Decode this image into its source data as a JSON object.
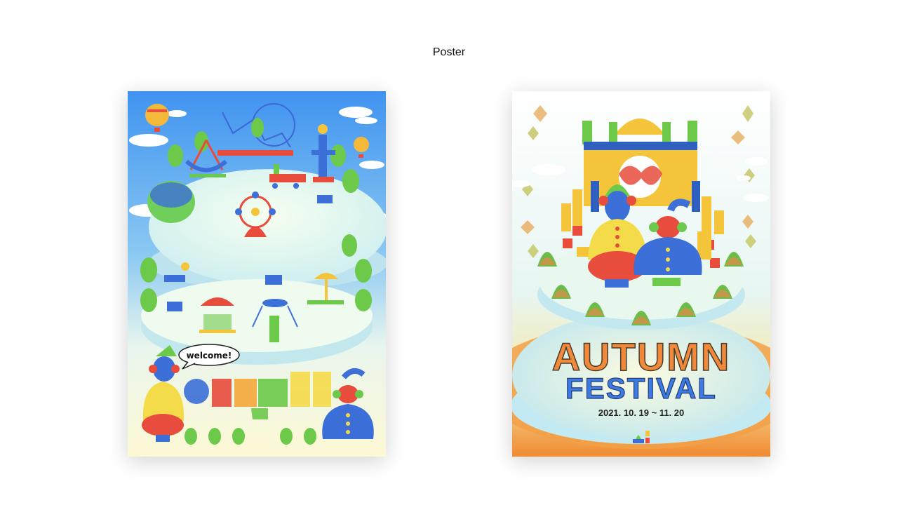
{
  "page": {
    "title": "Poster"
  },
  "poster_left": {
    "speech_bubble": "welcome!",
    "colors": {
      "sky": "#4a9df0",
      "ground": "#fbf7d6",
      "platform": "#e6f7f4"
    }
  },
  "poster_right": {
    "title_line1": "AUTUMN",
    "title_line2": "FESTIVAL",
    "date": "2021. 10. 19 ~ 11. 20",
    "colors": {
      "title1": "#f08a3a",
      "title2": "#3a7be8",
      "bottom": "#f28a30"
    }
  }
}
